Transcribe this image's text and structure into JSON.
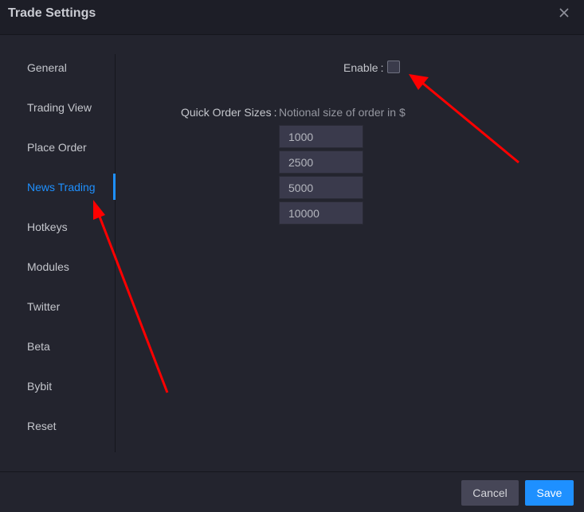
{
  "dialog": {
    "title": "Trade Settings",
    "close_icon": "close-icon"
  },
  "sidebar": {
    "active_index": 3,
    "active_color": "#1e90ff",
    "items": [
      {
        "label": "General"
      },
      {
        "label": "Trading View"
      },
      {
        "label": "Place Order"
      },
      {
        "label": "News Trading"
      },
      {
        "label": "Hotkeys"
      },
      {
        "label": "Modules"
      },
      {
        "label": "Twitter"
      },
      {
        "label": "Beta"
      },
      {
        "label": "Bybit"
      },
      {
        "label": "Reset"
      }
    ]
  },
  "news_trading": {
    "enable_label": "Enable",
    "enable_colon": ":",
    "enable_checked": false,
    "quick_order_sizes_label": "Quick Order Sizes",
    "quick_order_sizes_colon": ":",
    "quick_order_sizes_hint": "Notional size of order in $",
    "sizes": [
      "1000",
      "2500",
      "5000",
      "10000"
    ]
  },
  "footer": {
    "cancel_label": "Cancel",
    "save_label": "Save"
  },
  "annotations": {
    "arrow_color": "#ff0000",
    "arrows": [
      {
        "target": "enable-checkbox"
      },
      {
        "target": "sidebar-item-news-trading"
      }
    ]
  }
}
